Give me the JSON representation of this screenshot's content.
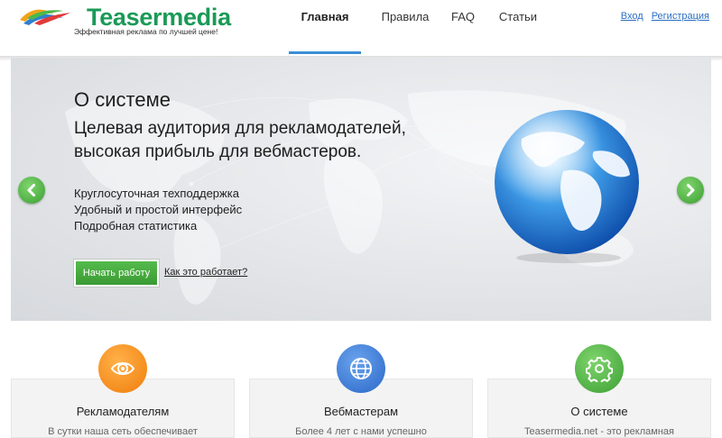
{
  "brand": {
    "name": "Teasermedia",
    "tagline": "Эффективная реклама по лучшей цене!",
    "color": "#1a9a56"
  },
  "nav": {
    "items": [
      {
        "label": "Главная",
        "active": true
      },
      {
        "label": "Правила",
        "active": false
      },
      {
        "label": "FAQ",
        "active": false
      },
      {
        "label": "Статьи",
        "active": false
      }
    ],
    "active_color": "#3b8fd6"
  },
  "auth": {
    "login": "Вход",
    "register": "Регистрация"
  },
  "hero": {
    "heading": "О системе",
    "subtitle_line1": "Целевая аудитория для рекламодателей,",
    "subtitle_line2": "высокая прибыль для вебмастеров.",
    "bullets": [
      "Круглосуточная техподдержка",
      "Удобный и простой интерфейс",
      "Подробная статистика"
    ],
    "start_button": "Начать работу",
    "how_link": "Как это работает?",
    "prev_icon": "chevron-left-icon",
    "next_icon": "chevron-right-icon",
    "accent_color": "#3c9f33"
  },
  "features": [
    {
      "title": "Рекламодателям",
      "text": "В сутки наша сеть обеспечивает",
      "icon": "eye-icon",
      "color": "#f07d0a"
    },
    {
      "title": "Вебмастерам",
      "text": "Более 4 лет с нами успешно",
      "icon": "globe-icon",
      "color": "#2a67c9"
    },
    {
      "title": "О системе",
      "text": "Teasermedia.net - это рекламная",
      "icon": "gear-icon",
      "color": "#3c9f33"
    }
  ]
}
